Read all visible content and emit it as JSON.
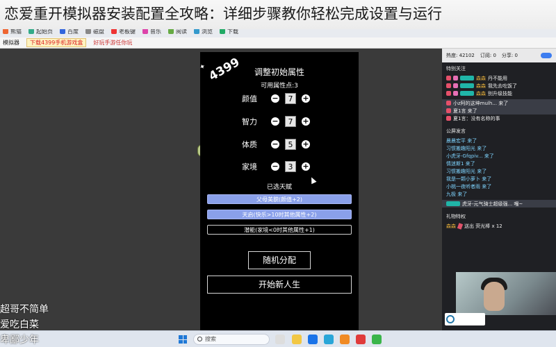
{
  "banner": {
    "title": "恋爱重开模拟器安装配置全攻略：详细步骤教你轻松完成设置与运行"
  },
  "browser": {
    "toolbar_items": [
      "熊猫",
      "起始页",
      "百度",
      "磁盘",
      "老板键",
      "音乐",
      "阅读",
      "浏览",
      "下载"
    ],
    "app_name": "模拟器",
    "ad_text": "下载4399手机游戏盒",
    "ad_text2": "好玩手游任你玩"
  },
  "game": {
    "logo": "4399",
    "title": "调整初始属性",
    "points_label": "可用属性点:3",
    "attributes": [
      {
        "label": "颜值",
        "value": "7"
      },
      {
        "label": "智力",
        "value": "7"
      },
      {
        "label": "体质",
        "value": "5"
      },
      {
        "label": "家境",
        "value": "3"
      }
    ],
    "minus_glyph": "−",
    "plus_glyph": "+",
    "selected_label": "已选天赋",
    "talents": [
      {
        "text": "父母美貌(颜值+2)",
        "selected": true
      },
      {
        "text": "天启(快乐>10时其他属性+2)",
        "selected": true
      },
      {
        "text": "潜能(家境<0时其他属性+1)",
        "selected": false
      }
    ],
    "random_btn": "随机分配",
    "start_btn": "开始新人生"
  },
  "panel": {
    "stats": {
      "hot": "热度: 42102",
      "sub": "订阅: 0",
      "share": "分享: 0"
    },
    "highlight_header": "特别关注",
    "highlight_rows": [
      {
        "user": "森森",
        "text": "丹不能用"
      },
      {
        "user": "森森",
        "text": "我先去吃饭了"
      },
      {
        "user": "森森",
        "text": "别升级技能"
      }
    ],
    "entries": [
      {
        "text": "小z阿的这坤mulh... 来了",
        "hl": true
      },
      {
        "text": "夏1言 来了",
        "hl": true
      },
      {
        "text": "夏1言：没有名称的事",
        "hl": false
      }
    ],
    "public_header": "公屏发言",
    "public_rows": [
      "晨晨宏平 来了",
      "习惯搬趣阳光 来了",
      "小虎牙-Gfqpiv... 来了",
      "情迷斯1 来了",
      "习惯搬趣阳光 来了",
      "我是一颗小萝卜 来了",
      "小桃一夜听者雨 来了",
      "九极 来了"
    ],
    "banner_msg": "虎牙-元气骑士超级强... 嘎~",
    "gift_header": "礼物特权",
    "gift_rows": [
      {
        "user": "森森",
        "text": "送出  荧光棒 x 12"
      }
    ]
  },
  "overlay": {
    "names": [
      "超哥不简单",
      "爱吃白菜",
      "卑鄙少年"
    ]
  },
  "taskbar": {
    "search_placeholder": "搜索"
  }
}
